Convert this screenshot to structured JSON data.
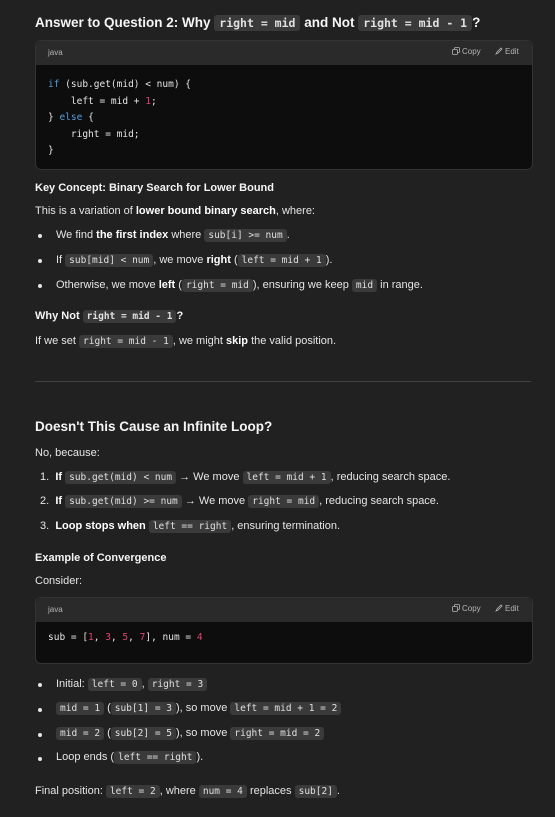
{
  "section1": {
    "heading_prefix": "Answer to Question 2: Why",
    "heading_code1": "right = mid",
    "heading_mid": "and Not",
    "heading_code2": "right = mid - 1",
    "heading_suffix": "?"
  },
  "codeblock1": {
    "lang": "java",
    "copy_label": "Copy",
    "edit_label": "Edit",
    "lines": [
      [
        "if",
        " (sub.get(mid) < num) {"
      ],
      [
        "    left = mid + ",
        "1",
        ";"
      ],
      [
        "} ",
        "else",
        " {"
      ],
      [
        "    right = mid;"
      ],
      [
        "}"
      ]
    ]
  },
  "key_concept": {
    "heading": "Key Concept: Binary Search for Lower Bound",
    "intro_a": "This is a variation of ",
    "intro_b": "lower bound binary search",
    "intro_c": ", where:",
    "b1_a": "We find ",
    "b1_b": "the first index",
    "b1_c": " where ",
    "b1_code": "sub[i] >= num",
    "b1_d": ".",
    "b2_a": "If ",
    "b2_code1": "sub[mid] < num",
    "b2_b": ", we move ",
    "b2_c": "right",
    "b2_d": " (",
    "b2_code2": "left = mid + 1",
    "b2_e": ").",
    "b3_a": "Otherwise, we move ",
    "b3_b": "left",
    "b3_c": " (",
    "b3_code1": "right = mid",
    "b3_d": "), ensuring we keep ",
    "b3_code2": "mid",
    "b3_e": " in range."
  },
  "why_not": {
    "heading_a": "Why Not",
    "heading_code": "right = mid - 1",
    "heading_b": "?",
    "p_a": "If we set ",
    "p_code": "right = mid - 1",
    "p_b": ", we might ",
    "p_c": "skip",
    "p_d": " the valid position."
  },
  "section2": {
    "heading": "Doesn't This Cause an Infinite Loop?",
    "intro": "No, because:",
    "i1_n": "1.",
    "i1_a": "If",
    "i1_code1": "sub.get(mid) < num",
    "i1_b": " → We move ",
    "i1_code2": "left = mid + 1",
    "i1_c": ", reducing search space.",
    "i2_n": "2.",
    "i2_a": "If",
    "i2_code1": "sub.get(mid) >= num",
    "i2_b": " → We move ",
    "i2_code2": "right = mid",
    "i2_c": ", reducing search space.",
    "i3_n": "3.",
    "i3_a": "Loop stops when",
    "i3_code": "left == right",
    "i3_b": ", ensuring termination."
  },
  "convergence": {
    "heading": "Example of Convergence",
    "consider": "Consider:"
  },
  "codeblock2": {
    "lang": "java",
    "copy_label": "Copy",
    "edit_label": "Edit",
    "line": [
      "sub = [",
      "1",
      ", ",
      "3",
      ", ",
      "5",
      ", ",
      "7",
      "], num = ",
      "4"
    ]
  },
  "steps": {
    "s1_a": "Initial: ",
    "s1_code1": "left = 0",
    "s1_b": ", ",
    "s1_code2": "right = 3",
    "s2_code1": "mid = 1",
    "s2_a": " (",
    "s2_code2": "sub[1] = 3",
    "s2_b": "), so move ",
    "s2_code3": "left = mid + 1 = 2",
    "s3_code1": "mid = 2",
    "s3_a": " (",
    "s3_code2": "sub[2] = 5",
    "s3_b": "), so move ",
    "s3_code3": "right = mid = 2",
    "s4_a": "Loop ends (",
    "s4_code": "left == right",
    "s4_b": ")."
  },
  "final": {
    "a": "Final position: ",
    "code1": "left = 2",
    "b": ", where ",
    "code2": "num = 4",
    "c": " replaces ",
    "code3": "sub[2]",
    "d": "."
  }
}
